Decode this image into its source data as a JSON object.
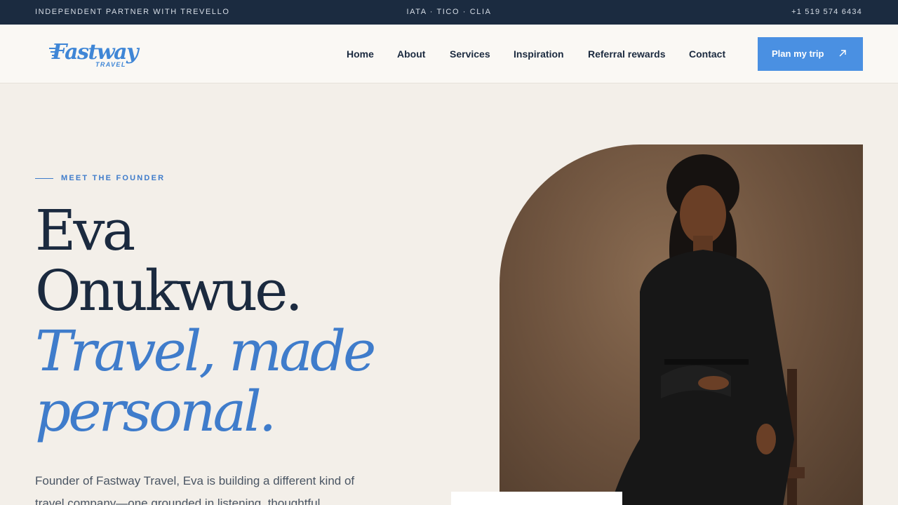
{
  "topbar": {
    "left": "INDEPENDENT PARTNER WITH TREVELLO",
    "center": "IATA · TICO · CLIA",
    "phone": "+1 519 574 6434"
  },
  "brand": {
    "name": "Fastway",
    "sub": "TRAVEL",
    "color": "#3f86d6"
  },
  "nav": {
    "items": [
      {
        "label": "Home"
      },
      {
        "label": "About"
      },
      {
        "label": "Services"
      },
      {
        "label": "Inspiration"
      },
      {
        "label": "Referral rewards"
      },
      {
        "label": "Contact"
      }
    ],
    "cta": {
      "label": "Plan my trip",
      "icon": "arrow-up-right-icon",
      "color": "#4a90e2"
    }
  },
  "hero": {
    "eyebrow": "MEET THE FOUNDER",
    "name_line1": "Eva",
    "name_line2": "Onukwue.",
    "tagline_line1": "Travel, made",
    "tagline_line2": "personal.",
    "intro": "Founder of Fastway Travel, Eva is building a different kind of travel company—one grounded in listening, thoughtful"
  },
  "colors": {
    "navy": "#1b2b40",
    "accent_blue": "#3f7ccb",
    "background": "#f3efe9"
  }
}
